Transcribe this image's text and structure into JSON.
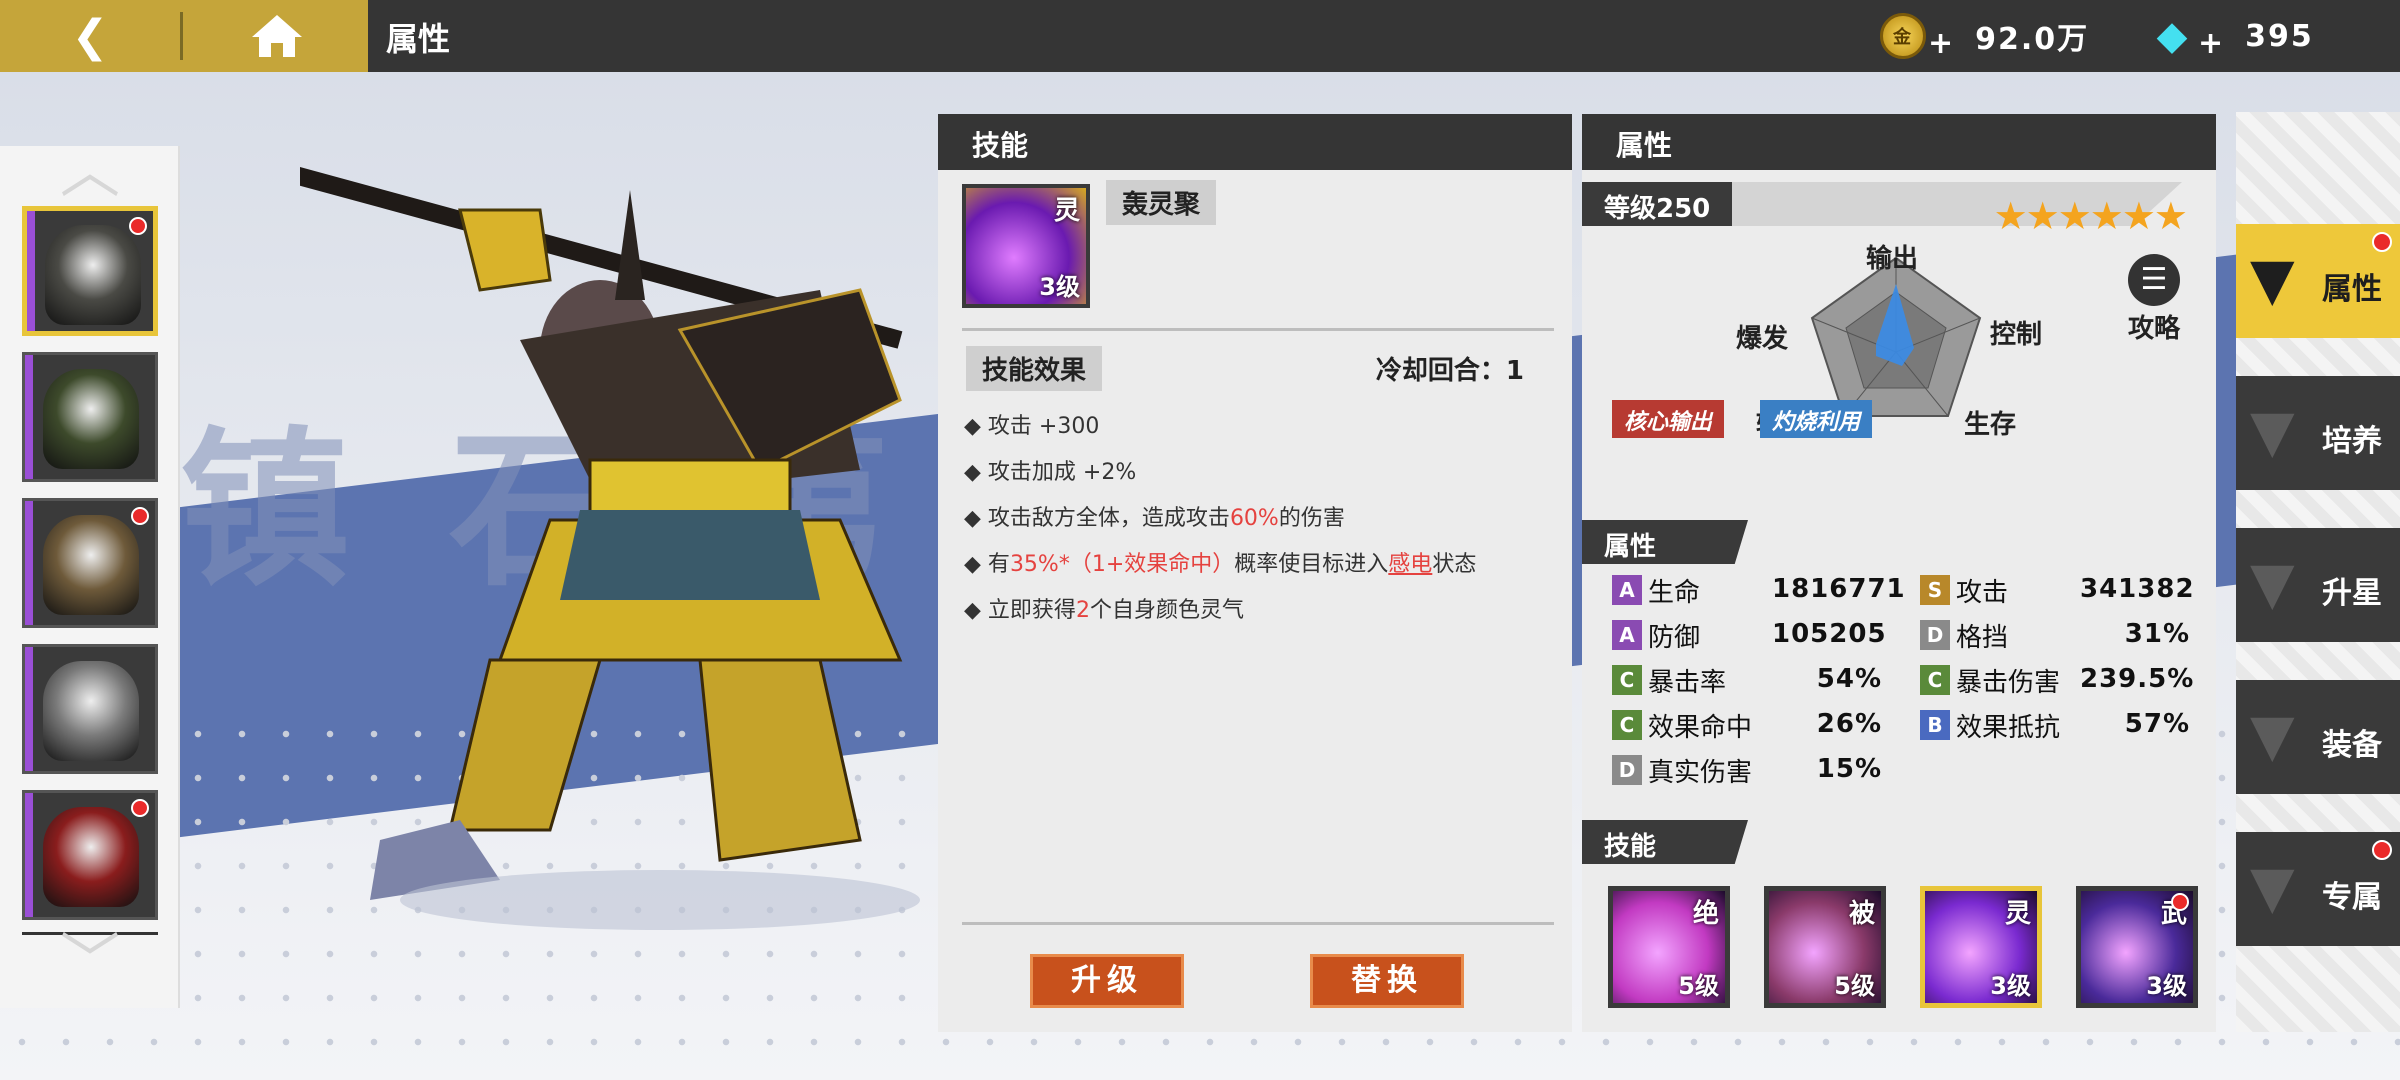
{
  "topbar": {
    "back_icon": "back-arrow-icon",
    "home_icon": "home-icon",
    "title": "属性",
    "gold_value": "92.0万",
    "gem_value": "395",
    "plus": "+",
    "coin_glyph": "金"
  },
  "hero_list": {
    "up_arrow": "︿",
    "down_arrow": "﹀",
    "heroes": [
      {
        "name": "hero-1",
        "selected": true,
        "color": "#4a4a45",
        "dot": true
      },
      {
        "name": "hero-2",
        "selected": false,
        "color": "#3d4a2b",
        "dot": false
      },
      {
        "name": "hero-3",
        "selected": false,
        "color": "#6e5a3a",
        "dot": true
      },
      {
        "name": "hero-4",
        "selected": false,
        "color": "#7a7a7a",
        "dot": false
      },
      {
        "name": "hero-5",
        "selected": false,
        "color": "#8a1d1d",
        "dot": true
      }
    ]
  },
  "background_text": "镇 石 第",
  "skill_panel": {
    "header": "技能",
    "skill_name": "轰灵聚",
    "skill_glyph": "灵",
    "skill_level": "3级",
    "effect_title": "技能效果",
    "cooldown": "冷却回合：1",
    "effects": [
      {
        "a": "攻击 +300"
      },
      {
        "a": "攻击加成 +2%"
      },
      {
        "a": "攻击敌方全体，造成攻击",
        "r": "60%",
        "b": "的伤害"
      },
      {
        "a": "有",
        "r": "35%*（1+效果命中）",
        "b": "概率使目标进入",
        "r2": "感电",
        "c": "状态"
      },
      {
        "a": "立即获得",
        "r": "2",
        "b": "个自身颜色灵气"
      }
    ],
    "upgrade_button": "升级",
    "replace_button": "替换"
  },
  "attr_panel": {
    "header": "属性",
    "level": "等级250",
    "stars": "★★★★★★",
    "star_count": 6,
    "radar": {
      "output": "输出",
      "control": "控制",
      "survive": "生存",
      "support": "辅助",
      "burst": "爆发"
    },
    "guide_label": "攻略",
    "badges": [
      {
        "text": "核心输出",
        "color": "#b73a32"
      },
      {
        "text": "灼烧利用",
        "color": "#3a7fc4"
      }
    ],
    "attr_title": "属性",
    "attributes": [
      {
        "grade": "A",
        "grade_color": "#8a4bb2",
        "label": "生命",
        "value": "1816771"
      },
      {
        "grade": "S",
        "grade_color": "#b8882a",
        "label": "攻击",
        "value": "341382"
      },
      {
        "grade": "A",
        "grade_color": "#8a4bb2",
        "label": "防御",
        "value": "105205"
      },
      {
        "grade": "D",
        "grade_color": "#8a8a8a",
        "label": "格挡",
        "value": "31%"
      },
      {
        "grade": "C",
        "grade_color": "#5a8a3a",
        "label": "暴击率",
        "value": "54%"
      },
      {
        "grade": "C",
        "grade_color": "#5a8a3a",
        "label": "暴击伤害",
        "value": "239.5%"
      },
      {
        "grade": "C",
        "grade_color": "#5a8a3a",
        "label": "效果命中",
        "value": "26%"
      },
      {
        "grade": "B",
        "grade_color": "#4a6ac0",
        "label": "效果抵抗",
        "value": "57%"
      },
      {
        "grade": "D",
        "grade_color": "#8a8a8a",
        "label": "真实伤害",
        "value": "15%"
      }
    ],
    "skills_title": "技能",
    "skills": [
      {
        "glyph": "绝",
        "level": "5级",
        "color": "#c23ac2",
        "selected": false,
        "dot": false
      },
      {
        "glyph": "被",
        "level": "5级",
        "color": "#8a3a6a",
        "selected": false,
        "dot": false
      },
      {
        "glyph": "灵",
        "level": "3级",
        "color": "#7a2ad0",
        "selected": true,
        "dot": false
      },
      {
        "glyph": "武",
        "level": "3级",
        "color": "#4a2a9a",
        "selected": false,
        "dot": true
      }
    ]
  },
  "side_nav": [
    {
      "label": "属性",
      "selected": true,
      "dot": true
    },
    {
      "label": "培养",
      "selected": false,
      "dot": false
    },
    {
      "label": "升星",
      "selected": false,
      "dot": false
    },
    {
      "label": "装备",
      "selected": false,
      "dot": false
    },
    {
      "label": "专属",
      "selected": false,
      "dot": true
    }
  ]
}
